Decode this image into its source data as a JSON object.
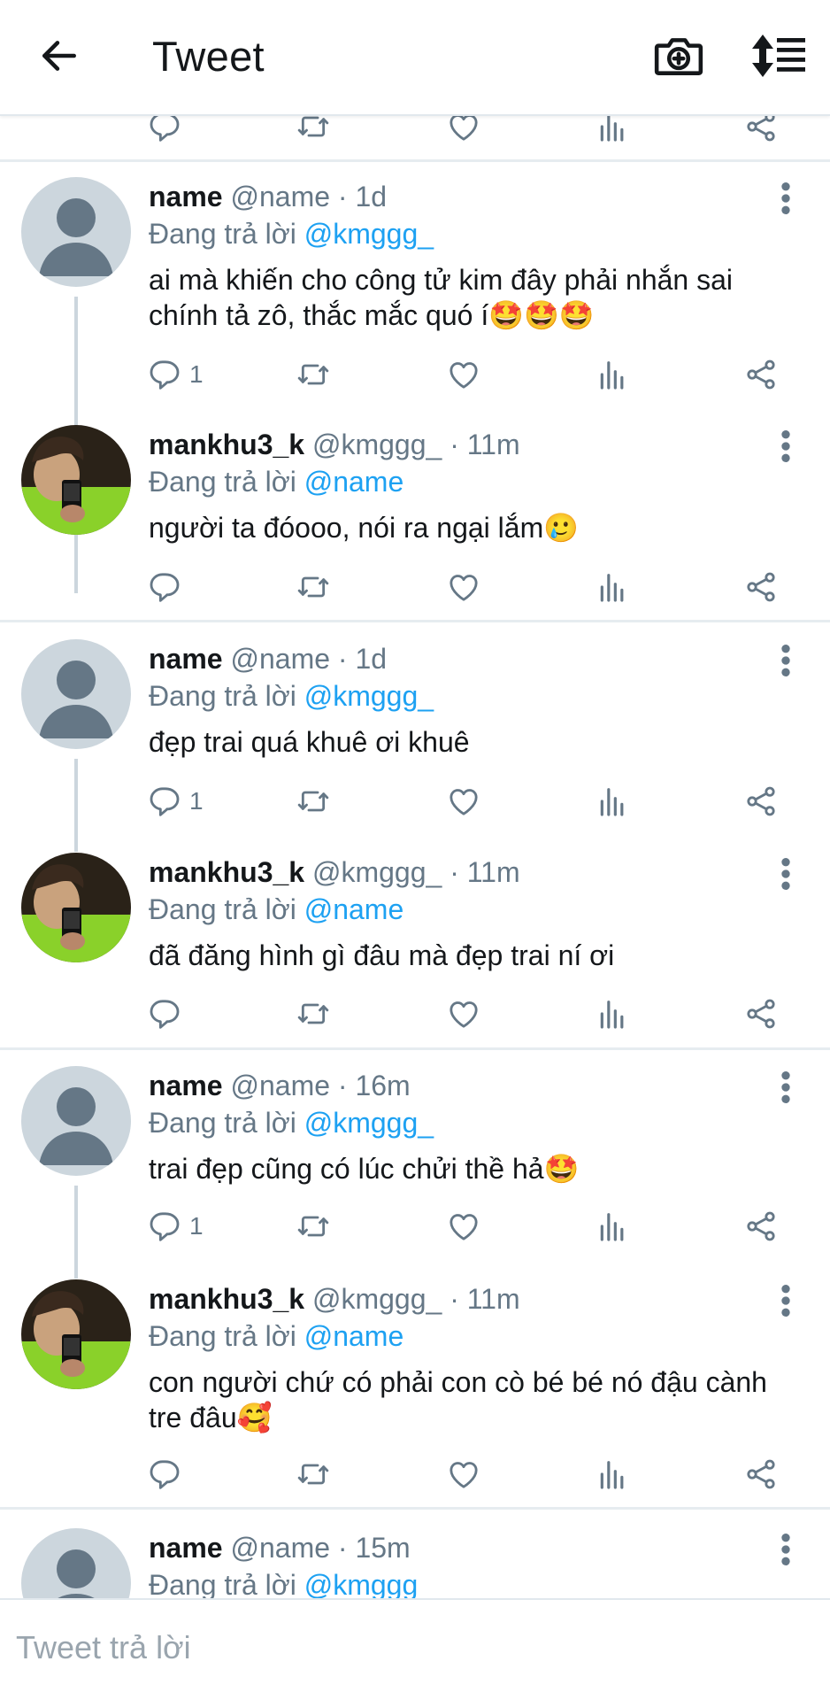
{
  "header": {
    "title": "Tweet"
  },
  "tweets": [
    {
      "name": "name",
      "handle": "@name",
      "time": "· 1d",
      "reply_prefix": "Đang trả lời",
      "reply_to": "@kmggg_",
      "text": "ai mà khiến cho công tử kim đây phải nhắn sai chính tả zô, thắc mắc quó í🤩🤩🤩",
      "reply_count": "1",
      "avatar": "default"
    },
    {
      "name": "mankhu3_k",
      "handle": "@kmggg_",
      "time": "· 11m",
      "reply_prefix": "Đang trả lời",
      "reply_to": "@name",
      "text": "người ta đóooo, nói ra ngại lắm🥲",
      "reply_count": "",
      "avatar": "photo"
    },
    {
      "name": "name",
      "handle": "@name",
      "time": "· 1d",
      "reply_prefix": "Đang trả lời",
      "reply_to": "@kmggg_",
      "text": "đẹp trai quá khuê ơi khuê",
      "reply_count": "1",
      "avatar": "default"
    },
    {
      "name": "mankhu3_k",
      "handle": "@kmggg_",
      "time": "· 11m",
      "reply_prefix": "Đang trả lời",
      "reply_to": "@name",
      "text": "đã đăng hình gì đâu mà đẹp trai ní ơi",
      "reply_count": "",
      "avatar": "photo"
    },
    {
      "name": "name",
      "handle": "@name",
      "time": "· 16m",
      "reply_prefix": "Đang trả lời",
      "reply_to": "@kmggg_",
      "text": "trai đẹp cũng có lúc chửi thề hả🤩",
      "reply_count": "1",
      "avatar": "default"
    },
    {
      "name": "mankhu3_k",
      "handle": "@kmggg_",
      "time": "· 11m",
      "reply_prefix": "Đang trả lời",
      "reply_to": "@name",
      "text": "con người chứ có phải con cò bé bé nó đậu cành tre đâu🥰",
      "reply_count": "",
      "avatar": "photo"
    },
    {
      "name": "name",
      "handle": "@name",
      "time": "· 15m",
      "reply_prefix": "Đang trả lời",
      "reply_to": "@kmggg_",
      "text": "",
      "reply_count": "",
      "avatar": "default"
    }
  ],
  "composer": {
    "placeholder": "Tweet trả lời"
  },
  "icons": {
    "back": "arrow-left-icon",
    "camera": "camera-plus-icon",
    "sort": "sort-icon",
    "reply": "reply-icon",
    "retweet": "retweet-icon",
    "like": "heart-icon",
    "stats": "analytics-icon",
    "share": "share-icon",
    "more": "more-vertical-icon"
  },
  "colors": {
    "link": "#1da1f2",
    "secondary": "#657786",
    "divider": "#e6ecf0"
  }
}
